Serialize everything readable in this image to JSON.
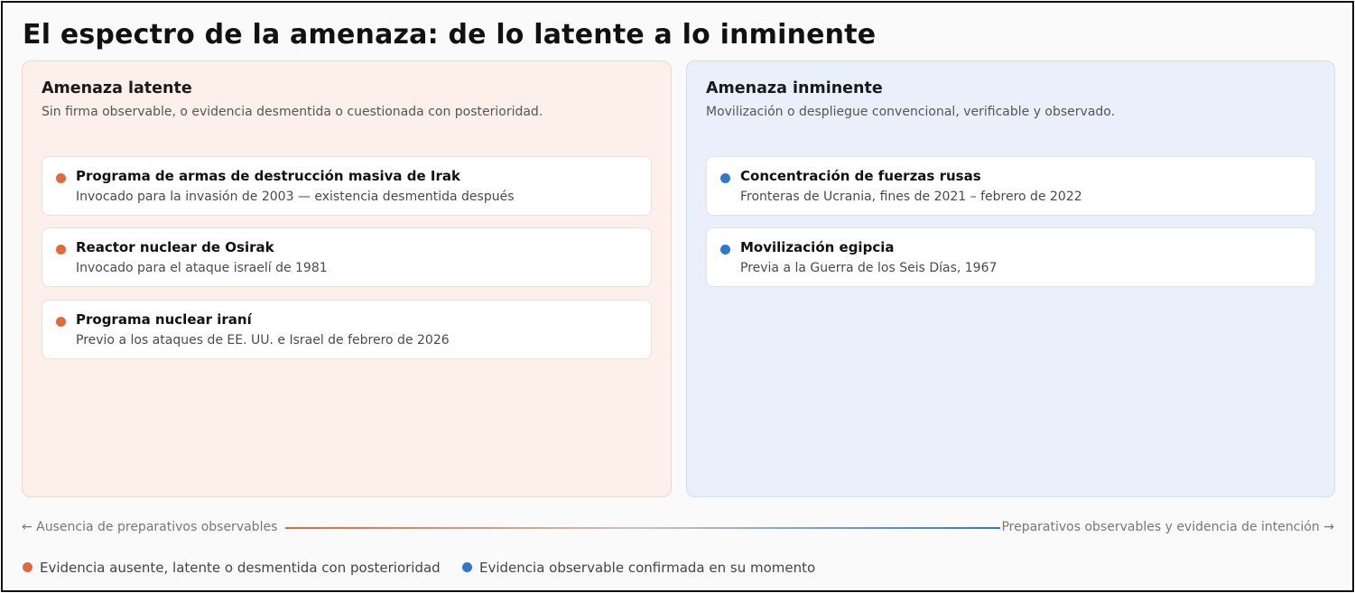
{
  "title": "El espectro de la amenaza: de lo latente a lo inminente",
  "colors": {
    "latent": "#e06a3a",
    "imminent": "#2f78d0",
    "latent_panel_bg": "#fdefea",
    "imminent_panel_bg": "#e9f0fb"
  },
  "panels": {
    "latent": {
      "heading": "Amenaza latente",
      "description": "Sin firma observable, o evidencia desmentida o cuestionada con posterioridad.",
      "cases": [
        {
          "title": "Programa de armas de destrucción masiva de Irak",
          "subtitle": "Invocado para la invasión de 2003 — existencia desmentida después"
        },
        {
          "title": "Reactor nuclear de Osirak",
          "subtitle": "Invocado para el ataque israelí de 1981"
        },
        {
          "title": "Programa nuclear iraní",
          "subtitle": "Previo a los ataques de EE. UU. e Israel de febrero de 2026"
        }
      ]
    },
    "imminent": {
      "heading": "Amenaza inminente",
      "description": "Movilización o despliegue convencional, verificable y observado.",
      "cases": [
        {
          "title": "Concentración de fuerzas rusas",
          "subtitle": "Fronteras de Ucrania, fines de 2021 – febrero de 2022"
        },
        {
          "title": "Movilización egipcia",
          "subtitle": "Previa a la Guerra de los Seis Días, 1967"
        }
      ]
    }
  },
  "axis": {
    "left_label": "← Ausencia de preparativos observables",
    "right_label": "Preparativos observables y evidencia de intención →"
  },
  "legend": {
    "latent_label": "Evidencia ausente, latente o desmentida con posterioridad",
    "imminent_label": "Evidencia observable confirmada en su momento"
  }
}
